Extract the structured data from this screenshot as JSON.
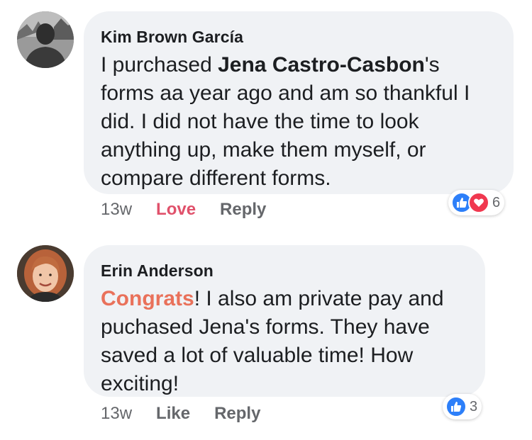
{
  "comments": [
    {
      "author": "Kim Brown García",
      "text_before": "I purchased ",
      "text_bold": "Jena Castro-Casbon",
      "text_after": "'s forms aa year ago and am so thankful I did. I did not have the time to look anything up, make them myself, or compare different forms.",
      "time": "13w",
      "action_primary": "Love",
      "action_reply": "Reply",
      "reactions": [
        "like-icon",
        "heart-icon"
      ],
      "reaction_count": "6",
      "avatar_icon": "user-avatar"
    },
    {
      "author": "Erin Anderson",
      "tag": "Congrats",
      "text_after": "! I also am private pay and puchased Jena's forms. They have saved a lot of valuable time! How exciting!",
      "time": "13w",
      "action_primary": "Like",
      "action_reply": "Reply",
      "reactions": [
        "like-icon"
      ],
      "reaction_count": "3",
      "avatar_icon": "user-avatar"
    }
  ],
  "colors": {
    "bubble": "#f0f2f5",
    "love": "#e0516b",
    "tag": "#e9715a",
    "like_blue": "#2d7ff9",
    "heart_red": "#f0384f",
    "muted": "#65676b"
  }
}
